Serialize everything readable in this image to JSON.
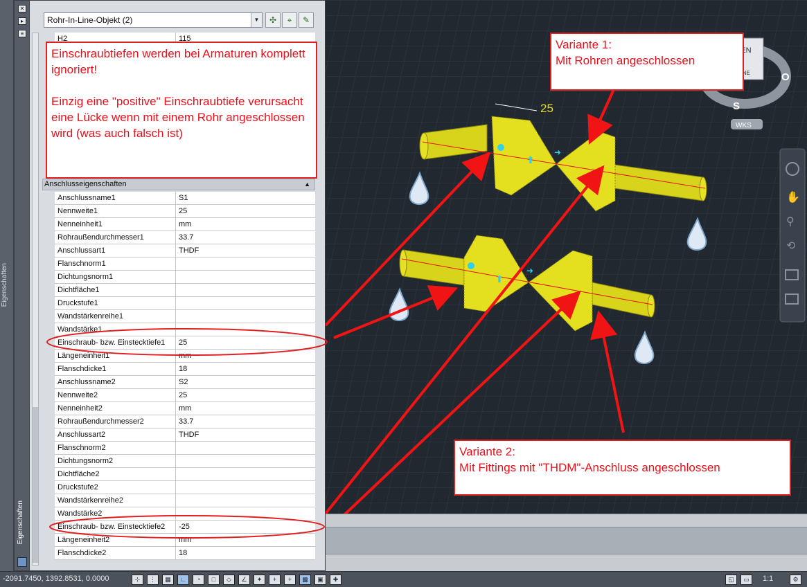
{
  "combo": {
    "value": "Rohr-In-Line-Objekt (2)"
  },
  "palette_title": "Eigenschaften",
  "top_rows": [
    {
      "key": "H2",
      "value": "115"
    }
  ],
  "section": {
    "label": "Anschlusseigenschaften"
  },
  "rows": [
    {
      "key": "Anschlussname1",
      "value": "S1"
    },
    {
      "key": "Nennweite1",
      "value": "25"
    },
    {
      "key": "Nenneinheit1",
      "value": "mm"
    },
    {
      "key": "Rohraußendurchmesser1",
      "value": "33.7"
    },
    {
      "key": "Anschlussart1",
      "value": "THDF"
    },
    {
      "key": "Flanschnorm1",
      "value": ""
    },
    {
      "key": "Dichtungsnorm1",
      "value": ""
    },
    {
      "key": "Dichtfläche1",
      "value": ""
    },
    {
      "key": "Druckstufe1",
      "value": ""
    },
    {
      "key": "Wandstärkenreihe1",
      "value": ""
    },
    {
      "key": "Wandstärke1",
      "value": ""
    },
    {
      "key": "Einschraub- bzw. Einstecktiefe1",
      "value": "25"
    },
    {
      "key": "Längeneinheit1",
      "value": "mm"
    },
    {
      "key": "Flanschdicke1",
      "value": "18"
    },
    {
      "key": "Anschlussname2",
      "value": "S2"
    },
    {
      "key": "Nennweite2",
      "value": "25"
    },
    {
      "key": "Nenneinheit2",
      "value": "mm"
    },
    {
      "key": "Rohraußendurchmesser2",
      "value": "33.7"
    },
    {
      "key": "Anschlussart2",
      "value": "THDF"
    },
    {
      "key": "Flanschnorm2",
      "value": ""
    },
    {
      "key": "Dichtungsnorm2",
      "value": ""
    },
    {
      "key": "Dichtfläche2",
      "value": ""
    },
    {
      "key": "Druckstufe2",
      "value": ""
    },
    {
      "key": "Wandstärkenreihe2",
      "value": ""
    },
    {
      "key": "Wandstärke2",
      "value": ""
    },
    {
      "key": "Einschraub- bzw. Einstecktiefe2",
      "value": "-25"
    },
    {
      "key": "Längeneinheit2",
      "value": "mm"
    },
    {
      "key": "Flanschdicke2",
      "value": "18"
    }
  ],
  "callouts": {
    "note": "Einschraubtiefen werden bei Armaturen komplett ignoriert!\n\nEinzig eine \"positive\" Einschraubtiefe verursacht eine Lücke wenn mit einem Rohr angeschlossen wird (was auch falsch ist)",
    "variant1": "Variante 1:\nMit Rohren angeschlossen",
    "variant2": "Variante 2:\nMit Fittings mit \"THDM\"-Anschluss angeschlossen"
  },
  "viewport": {
    "dimension_label": "25",
    "viewcube_top": "BEN",
    "viewcube_side": "RNE",
    "compass_s": "S",
    "compass_o": "O",
    "wcs": "WKS"
  },
  "status": {
    "coords": "-2091.7450, 1392.8531, 0.0000",
    "scale": "1:1"
  },
  "colors": {
    "accent_red": "#e02020",
    "pipe_yellow": "#e7e21c",
    "viewport_bg": "#212830"
  }
}
